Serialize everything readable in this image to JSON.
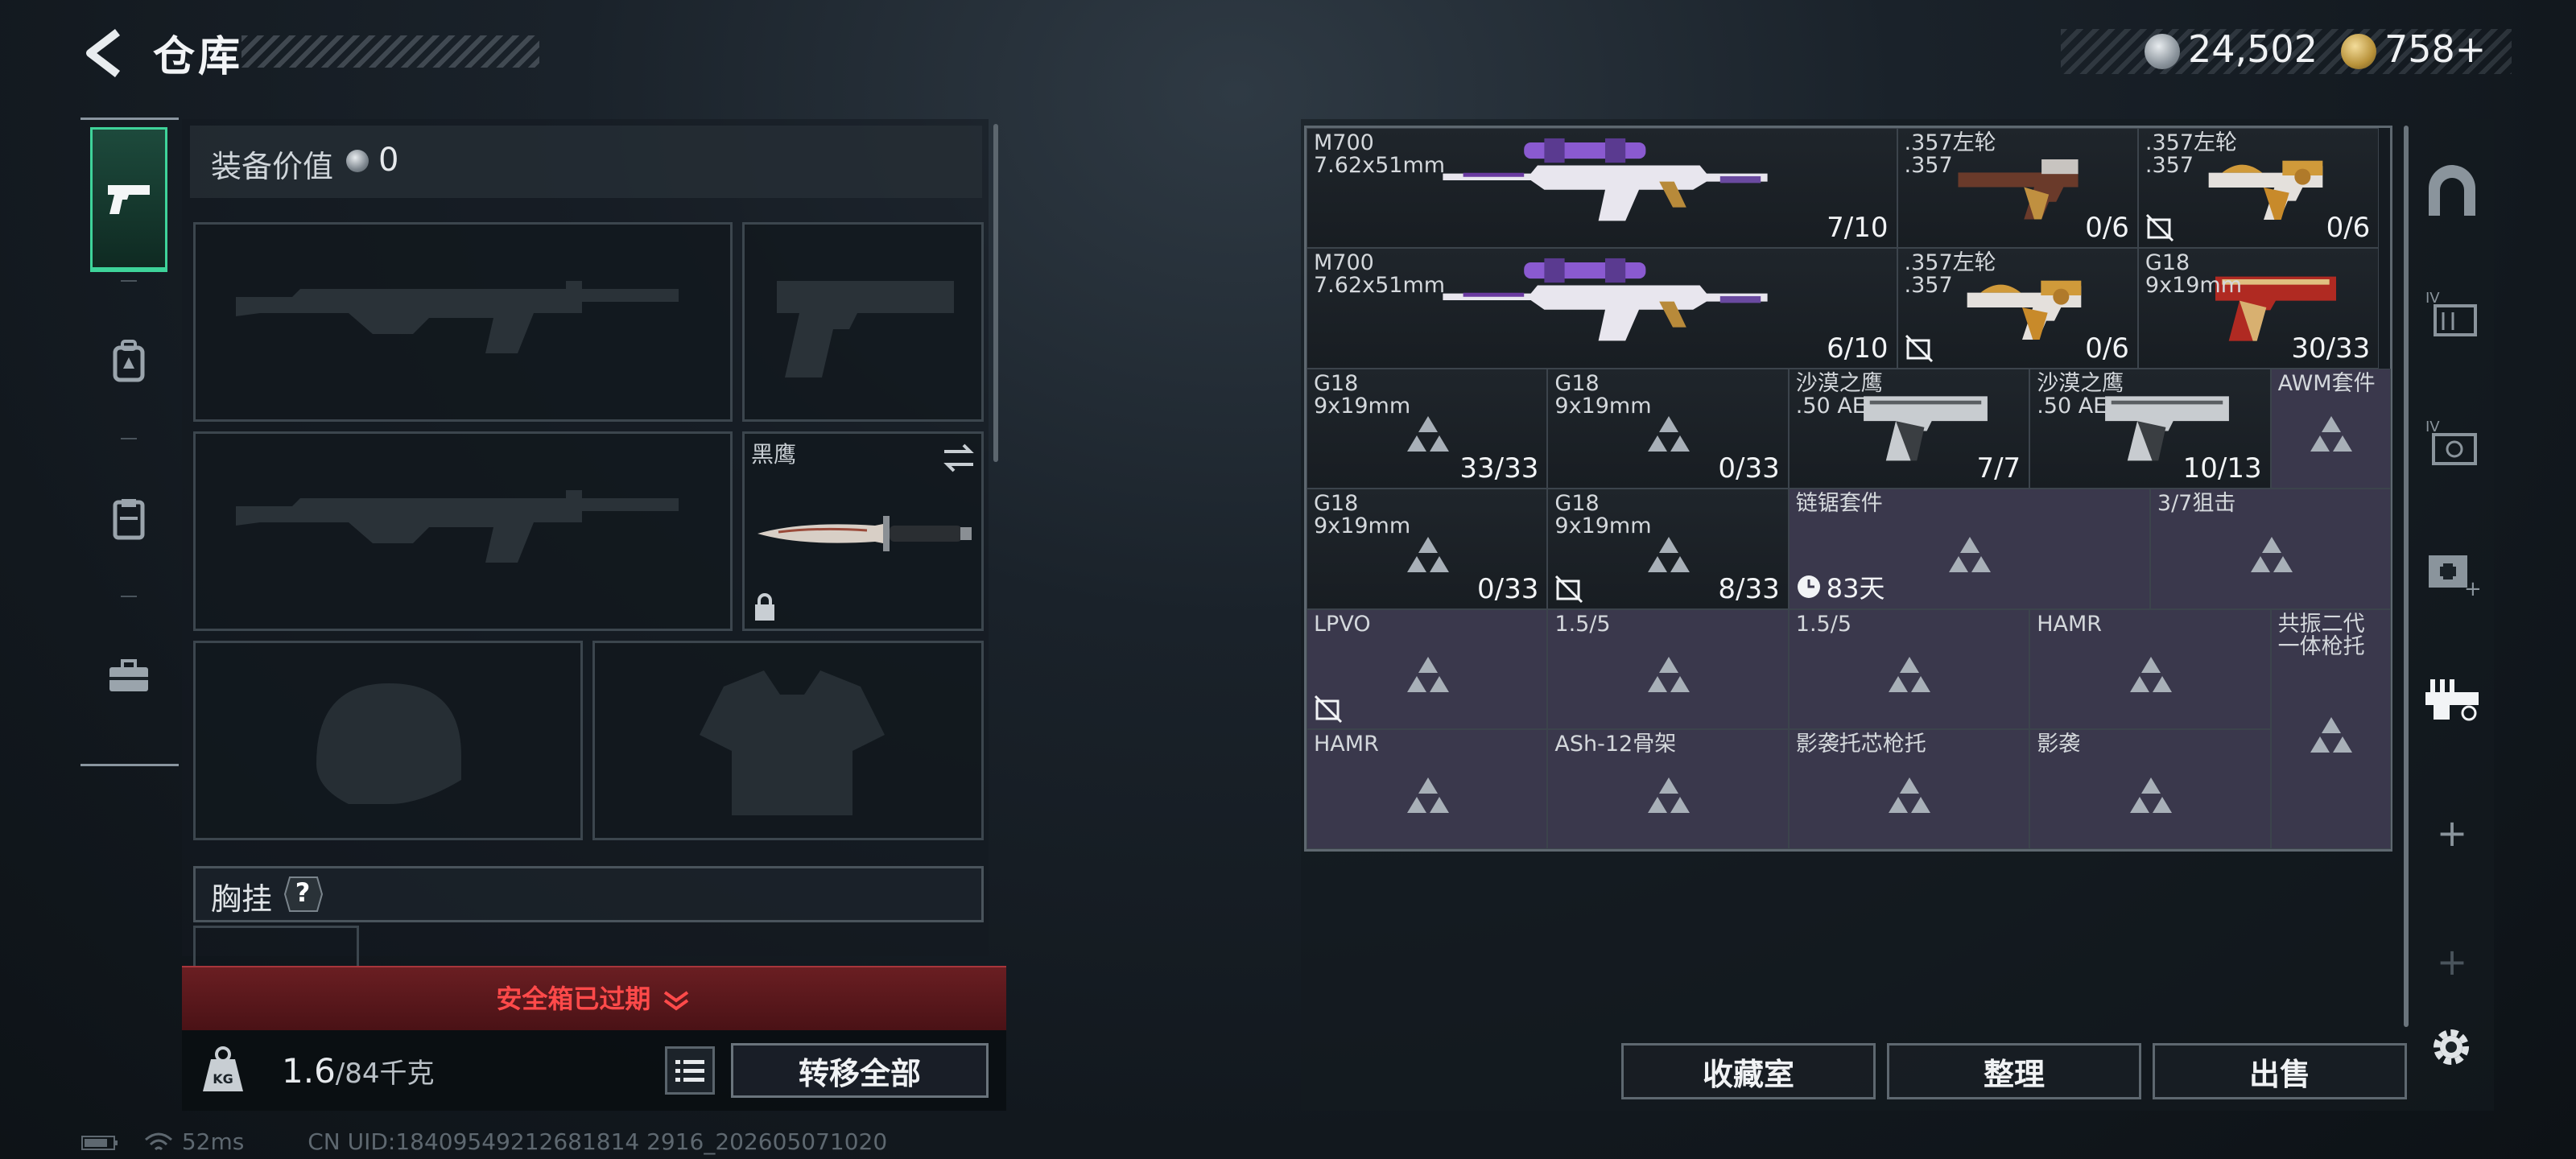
{
  "header": {
    "title": "仓库",
    "currency_silver": "24,502",
    "currency_gold": "758+"
  },
  "loadout": {
    "equip_value_label": "装备价值",
    "equip_value": "0",
    "knife_name": "黑鹰",
    "chest_label": "胸挂",
    "chest_help": "?",
    "safe_box_expired": "安全箱已过期",
    "weight_current": "1.6",
    "weight_max": "/84千克",
    "transfer_all": "转移全部"
  },
  "status_bar": {
    "ping": "52ms",
    "uid": "CN UID:18409549212681814 2916_202605071020"
  },
  "storage": {
    "cells": [
      {
        "name": "M700\n7.62x51mm",
        "count": "7/10"
      },
      {
        "name": ".357左轮\n.357",
        "count": "0/6"
      },
      {
        "name": ".357左轮\n.357",
        "count": "0/6"
      },
      {
        "name": "M700\n7.62x51mm",
        "count": "6/10"
      },
      {
        "name": ".357左轮\n.357",
        "count": "0/6"
      },
      {
        "name": "G18\n9x19mm",
        "count": "30/33"
      },
      {
        "name": "G18\n9x19mm",
        "count": "33/33"
      },
      {
        "name": "G18\n9x19mm",
        "count": "0/33"
      },
      {
        "name": "沙漠之鹰\n.50 AE",
        "count": "7/7"
      },
      {
        "name": "沙漠之鹰\n.50 AE",
        "count": "10/13"
      },
      {
        "name": "AWM套件",
        "count": ""
      },
      {
        "name": "G18\n9x19mm",
        "count": "0/33"
      },
      {
        "name": "G18\n9x19mm",
        "count": "8/33"
      },
      {
        "name": "链锯套件",
        "count": "83天"
      },
      {
        "name": "3/7狙击",
        "count": ""
      },
      {
        "name": "LPVO",
        "count": ""
      },
      {
        "name": "1.5/5",
        "count": ""
      },
      {
        "name": "1.5/5",
        "count": ""
      },
      {
        "name": "HAMR",
        "count": ""
      },
      {
        "name": "共振二代\n一体枪托",
        "count": ""
      },
      {
        "name": "HAMR",
        "count": ""
      },
      {
        "name": "ASh-12骨架",
        "count": ""
      },
      {
        "name": "影袭托芯枪托",
        "count": ""
      },
      {
        "name": "影袭",
        "count": ""
      }
    ]
  },
  "actions": {
    "collection": "收藏室",
    "sort": "整理",
    "sell": "出售"
  },
  "right_tabs": {
    "plus1": "+",
    "plus2": "+"
  },
  "colors": {
    "accent_green": "#3ed39a",
    "expired_red": "#ff4a4a",
    "attachment_cell": "#3a384c"
  }
}
